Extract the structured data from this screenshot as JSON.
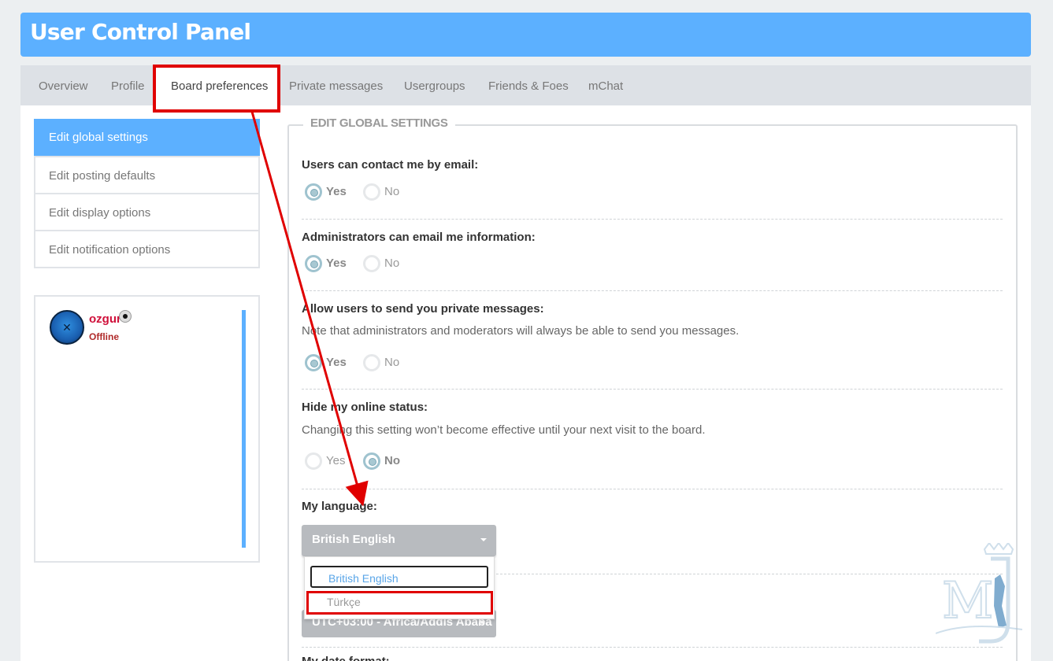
{
  "header": {
    "title": "User Control Panel"
  },
  "tabs": [
    {
      "label": "Overview"
    },
    {
      "label": "Profile"
    },
    {
      "label": "Board preferences",
      "active": true
    },
    {
      "label": "Private messages"
    },
    {
      "label": "Usergroups"
    },
    {
      "label": "Friends & Foes"
    },
    {
      "label": "mChat"
    }
  ],
  "sidebar": {
    "items": [
      {
        "label": "Edit global settings",
        "active": true
      },
      {
        "label": "Edit posting defaults"
      },
      {
        "label": "Edit display options"
      },
      {
        "label": "Edit notification options"
      }
    ]
  },
  "user": {
    "name": "ozgur",
    "status": "Offline"
  },
  "form": {
    "legend": "EDIT GLOBAL SETTINGS",
    "contact_email": {
      "label": "Users can contact me by email:",
      "yes": "Yes",
      "no": "No",
      "selected": "Yes"
    },
    "admin_email": {
      "label": "Administrators can email me information:",
      "yes": "Yes",
      "no": "No",
      "selected": "Yes"
    },
    "allow_pm": {
      "label": "Allow users to send you private messages:",
      "explain": "Note that administrators and moderators will always be able to send you messages.",
      "yes": "Yes",
      "no": "No",
      "selected": "Yes"
    },
    "hide_online": {
      "label": "Hide my online status:",
      "explain": "Changing this setting won’t become effective until your next visit to the board.",
      "yes": "Yes",
      "no": "No",
      "selected": "No"
    },
    "language": {
      "label": "My language:",
      "value": "British English",
      "options": [
        "British English",
        "Türkçe"
      ]
    },
    "timezone": {
      "value": "UTC+03:00 - Africa/Addis Ababa"
    },
    "next_label": "My date format:"
  },
  "colors": {
    "brand": "#5cb0ff",
    "highlight": "#e00000"
  }
}
